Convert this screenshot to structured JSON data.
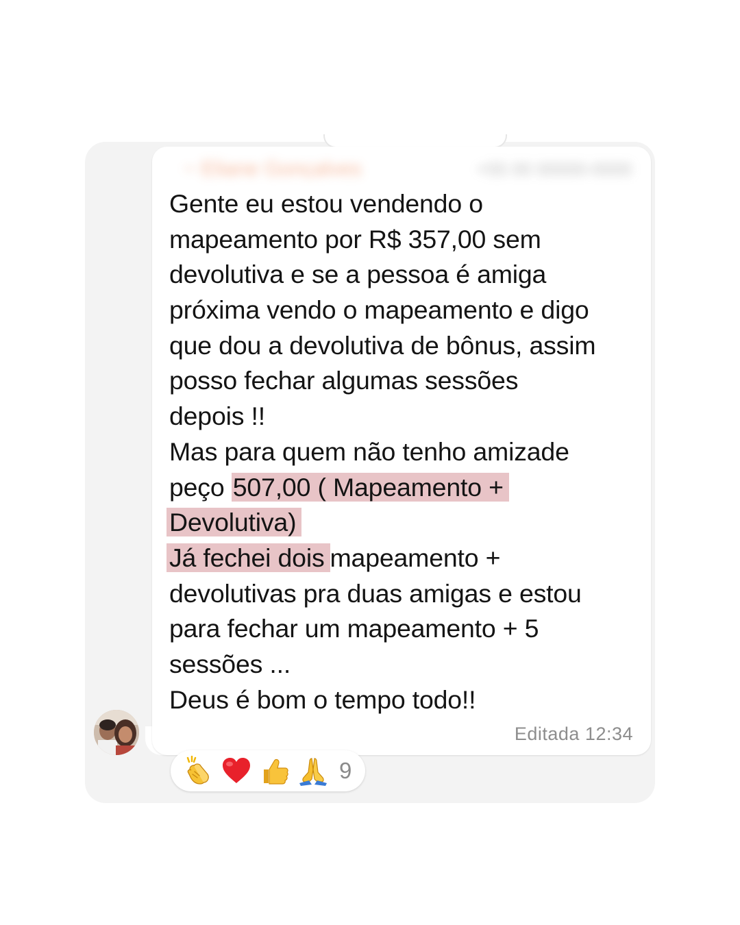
{
  "header": {
    "sender_name": "~ Eliane Gonçalves",
    "sender_phone": "+55 00 00000-0000"
  },
  "message": {
    "lines": [
      "Gente eu estou vendendo o",
      "mapeamento por R$ 357,00 sem",
      "devolutiva e se a pessoa é amiga",
      "próxima vendo o mapeamento e digo",
      "que dou a devolutiva de bônus, assim",
      "posso fechar algumas sessões",
      "depois !!",
      "Mas para quem não tenho amizade"
    ],
    "line9_plain": "peço",
    "line9_highlight": "507,00 ( Mapeamento +",
    "line10_highlight": "Devolutiva)",
    "line11_highlight": "Já fechei dois",
    "line11_plain": "mapeamento +",
    "lines_after": [
      "devolutivas pra duas amigas e estou",
      "para fechar um mapeamento + 5",
      "sessões ...",
      "Deus é bom o tempo todo!!"
    ],
    "highlight_color": "#e8c4c7"
  },
  "meta": {
    "status": "Editada",
    "time": "12:34"
  },
  "reactions": {
    "icons": [
      "clapping-hands-icon",
      "red-heart-icon",
      "thumbs-up-icon",
      "folded-hands-icon"
    ],
    "count": "9"
  }
}
